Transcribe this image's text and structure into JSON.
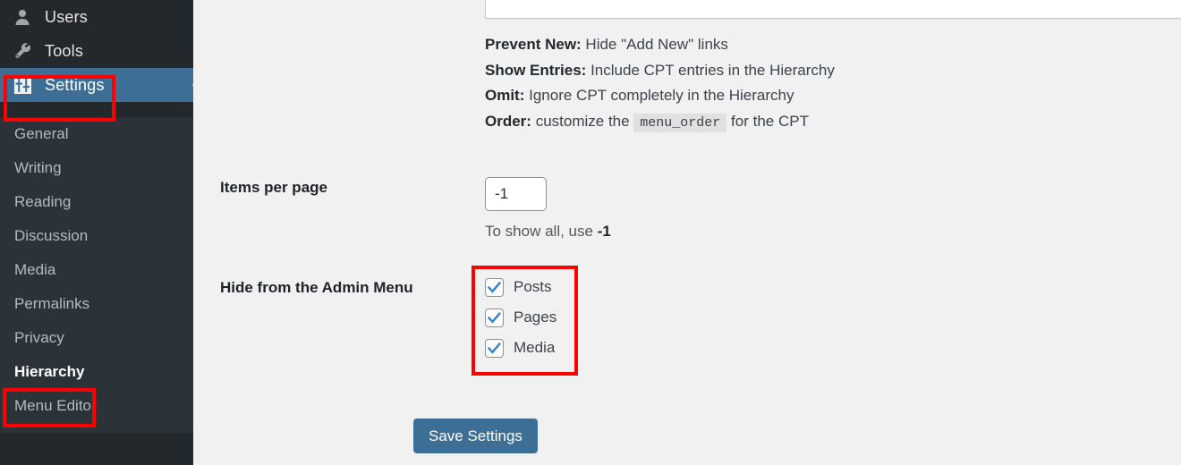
{
  "sidebar": {
    "top_items": [
      {
        "label": "Users",
        "icon": "user-icon",
        "current": false
      },
      {
        "label": "Tools",
        "icon": "wrench-icon",
        "current": false
      },
      {
        "label": "Settings",
        "icon": "settings-sliders-icon",
        "current": true
      }
    ],
    "sub_items": [
      {
        "label": "General",
        "current": false
      },
      {
        "label": "Writing",
        "current": false
      },
      {
        "label": "Reading",
        "current": false
      },
      {
        "label": "Discussion",
        "current": false
      },
      {
        "label": "Media",
        "current": false
      },
      {
        "label": "Permalinks",
        "current": false
      },
      {
        "label": "Privacy",
        "current": false
      },
      {
        "label": "Hierarchy",
        "current": true
      },
      {
        "label": "Menu Editor",
        "current": false
      }
    ]
  },
  "legend": {
    "lines": [
      {
        "term": "Prevent New:",
        "desc": " Hide \"Add New\" links"
      },
      {
        "term": "Show Entries:",
        "desc": " Include CPT entries in the Hierarchy"
      },
      {
        "term": "Omit:",
        "desc": " Ignore CPT completely in the Hierarchy"
      },
      {
        "term": "Order:",
        "desc_before": " customize the ",
        "code": "menu_order",
        "desc_after": " for the CPT"
      }
    ]
  },
  "items_per_page": {
    "label": "Items per page",
    "value": "-1",
    "help_before": "To show all, use ",
    "help_value": "-1"
  },
  "hide_from_admin_menu": {
    "label": "Hide from the Admin Menu",
    "options": [
      {
        "label": "Posts",
        "checked": true
      },
      {
        "label": "Pages",
        "checked": true
      },
      {
        "label": "Media",
        "checked": true
      }
    ]
  },
  "save_button": {
    "label": "Save Settings"
  },
  "colors": {
    "sidebar_bg": "#23282d",
    "submenu_bg": "#2c3338",
    "accent_blue": "#3c6e96",
    "annotation_red": "#ff0000",
    "content_bg": "#f1f1f1",
    "checkbox_check": "#3582c4"
  }
}
